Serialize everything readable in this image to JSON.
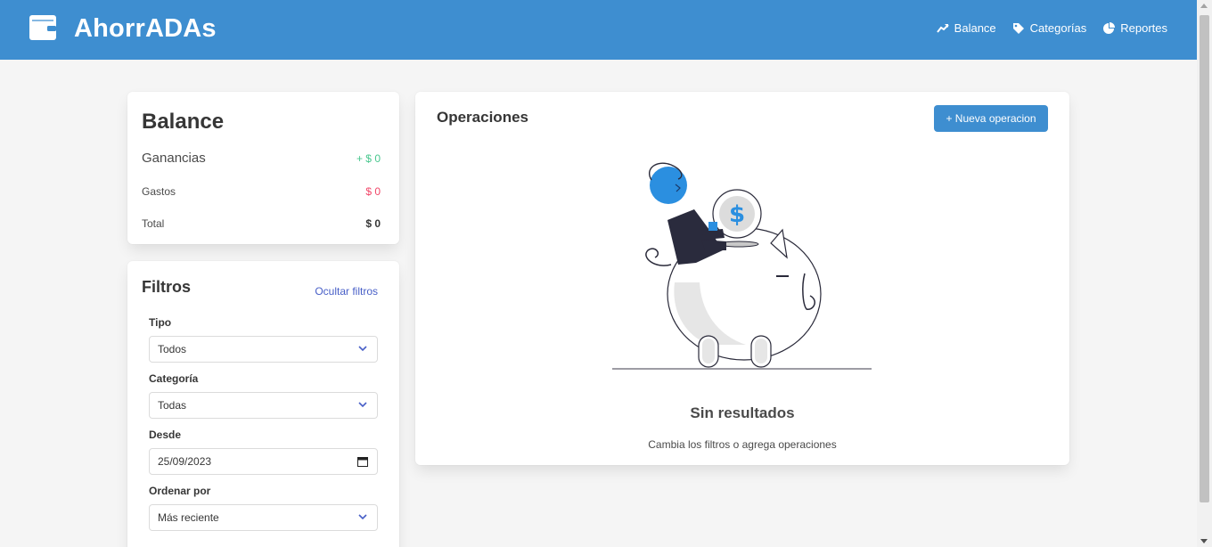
{
  "app": {
    "title": "AhorrADAs"
  },
  "nav": {
    "items": [
      {
        "label": "Balance",
        "icon": "chart-line-icon"
      },
      {
        "label": "Categorías",
        "icon": "tag-icon"
      },
      {
        "label": "Reportes",
        "icon": "pie-chart-icon"
      }
    ]
  },
  "balance": {
    "title": "Balance",
    "ganancias_label": "Ganancias",
    "ganancias_value": "+ $ 0",
    "gastos_label": "Gastos",
    "gastos_value": "$ 0",
    "total_label": "Total",
    "total_value": "$ 0"
  },
  "filters": {
    "title": "Filtros",
    "hide_label": "Ocultar filtros",
    "tipo_label": "Tipo",
    "tipo_value": "Todos",
    "categoria_label": "Categoría",
    "categoria_value": "Todas",
    "desde_label": "Desde",
    "desde_value": "25/09/2023",
    "orden_label": "Ordenar por",
    "orden_value": "Más reciente"
  },
  "operations": {
    "title": "Operaciones",
    "new_button": "+ Nueva operacion",
    "empty_title": "Sin resultados",
    "empty_subtitle": "Cambia los filtros o agrega operaciones"
  },
  "colors": {
    "primary": "#3e8ed0",
    "success": "#48c78e",
    "danger": "#f14668",
    "link": "#485fc7",
    "background": "#f5f5f5"
  }
}
